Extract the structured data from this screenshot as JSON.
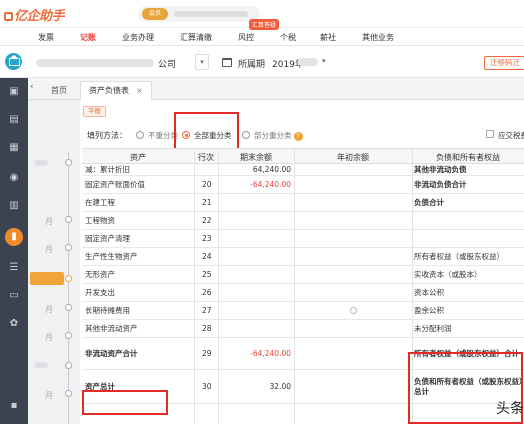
{
  "app": {
    "logo_text": "亿企助手",
    "vip_label": "会员"
  },
  "menu": {
    "badge": "汇算答疑",
    "items": [
      {
        "label": "发票",
        "active": false
      },
      {
        "label": "记账",
        "active": true
      },
      {
        "label": "业务办理",
        "active": false
      },
      {
        "label": "汇算清缴",
        "active": false
      },
      {
        "label": "风控",
        "active": false
      },
      {
        "label": "个税",
        "active": false
      },
      {
        "label": "薪社",
        "active": false
      },
      {
        "label": "其他业务",
        "active": false
      }
    ]
  },
  "company": {
    "name_suffix": "公司",
    "period_label": "所属期",
    "period_value": "2019年",
    "migrate_button": "迁移码迁"
  },
  "tabs": {
    "items": [
      {
        "label": "首页",
        "current": false
      },
      {
        "label": "资产负债表",
        "current": true
      }
    ],
    "close_glyph": "×"
  },
  "timeline": {
    "labels": [
      "月",
      "月",
      "月",
      "月",
      "月"
    ]
  },
  "report": {
    "standard_badge": "平衡",
    "fill_method_label": "填列方法：",
    "options": [
      {
        "label": "不重分类",
        "selected": false
      },
      {
        "label": "全部重分类",
        "selected": true
      },
      {
        "label": "部分重分类",
        "selected": false
      }
    ],
    "help_glyph": "?",
    "checkbox_label": "应交税费"
  },
  "table": {
    "headers": {
      "asset": "资产",
      "line": "行次",
      "end_balance": "期末余额",
      "begin_balance": "年初余额",
      "liability": "负债和所有者权益"
    },
    "rows": [
      {
        "name": "减：累计折旧",
        "line": "",
        "end": "64,240.00",
        "begin": "",
        "right": "其他非流动负债"
      },
      {
        "name": "固定资产账面价值",
        "line": "20",
        "end": "-64,240.00",
        "begin": "",
        "right": "非流动负债合计"
      },
      {
        "name": "在建工程",
        "line": "21",
        "end": "",
        "begin": "",
        "right": "负债合计"
      },
      {
        "name": "工程物资",
        "line": "22",
        "end": "",
        "begin": "",
        "right": ""
      },
      {
        "name": "固定资产清理",
        "line": "23",
        "end": "",
        "begin": "",
        "right": ""
      },
      {
        "name": "生产性生物资产",
        "line": "24",
        "end": "",
        "begin": "",
        "right": "所有者权益（或股东权益）"
      },
      {
        "name": "无形资产",
        "line": "25",
        "end": "",
        "begin": "",
        "right": "实收资本（或股本）"
      },
      {
        "name": "开发支出",
        "line": "26",
        "end": "",
        "begin": "",
        "right": "资本公积"
      },
      {
        "name": "长期待摊费用",
        "line": "27",
        "end": "",
        "begin": "",
        "right": "盈余公积"
      },
      {
        "name": "其他非流动资产",
        "line": "28",
        "end": "",
        "begin": "",
        "right": "未分配利润"
      },
      {
        "name": "非流动资产合计",
        "line": "29",
        "end": "-64,240.00",
        "begin": "",
        "right": "所有者权益（或股东权益）合计"
      },
      {
        "name": "资产总计",
        "line": "30",
        "end": "32.00",
        "begin": "",
        "right": "负债和所有者权益（或股东权益）总计"
      }
    ]
  },
  "watermark": "头条",
  "colors": {
    "accent": "#f26b3a",
    "active_menu": "#e8453c",
    "highlight_box": "#e22b24",
    "sidebar": "#3c4350",
    "timeline_current": "#f0a53b"
  }
}
